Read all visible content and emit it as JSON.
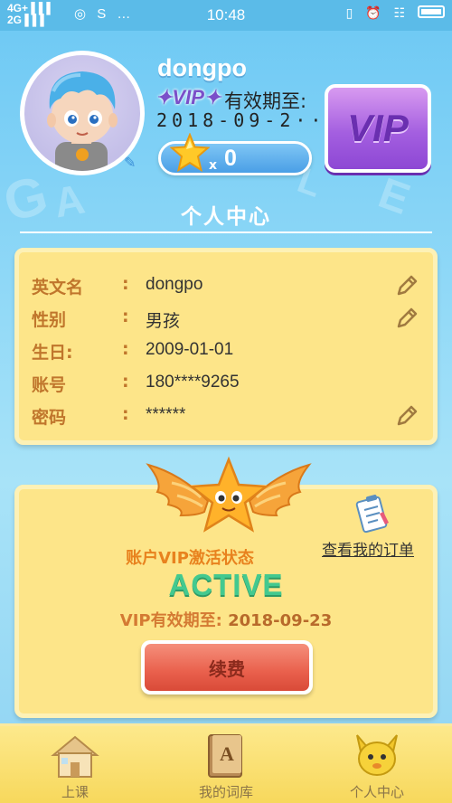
{
  "status_bar": {
    "network_top": "4G+",
    "network_bottom": "2G",
    "time": "10:48",
    "left_icons": "◎ S …",
    "right_icons": "▯ ⏰ ☷"
  },
  "profile": {
    "username": "dongpo",
    "vip_tag": "✦VIP✦",
    "validity_label": "有效期至:",
    "validity_date": "2018-09-2··",
    "star_multiplier": "x",
    "star_count": "0",
    "vip_button_label": "VIP"
  },
  "section_title": "个人中心",
  "info": {
    "colon": ":",
    "rows": [
      {
        "label": "英文名",
        "value": "dongpo",
        "editable": true
      },
      {
        "label": "性别",
        "value": "男孩",
        "editable": true
      },
      {
        "label": "生日:",
        "value": "2009-01-01",
        "editable": false
      },
      {
        "label": "账号",
        "value": "180****9265",
        "editable": false
      },
      {
        "label": "密码",
        "value": "******",
        "editable": true
      }
    ]
  },
  "vip": {
    "order_link": "查看我的订单",
    "status_title": "账户VIP激活状态",
    "status": "ACTIVE",
    "expire_label": "VIP有效期至:",
    "expire_date": "2018-09-23",
    "renew_label": "续费"
  },
  "tabs": [
    {
      "label": "上课",
      "icon": "house-icon"
    },
    {
      "label": "我的词库",
      "icon": "book-icon"
    },
    {
      "label": "个人中心",
      "icon": "mascot-icon"
    }
  ],
  "colors": {
    "background": "#8fd8f7",
    "card": "#fde589",
    "label": "#c0762c",
    "active_green": "#43c98f",
    "vip_purple": "#a45fe0",
    "renew_red": "#e9604c"
  }
}
